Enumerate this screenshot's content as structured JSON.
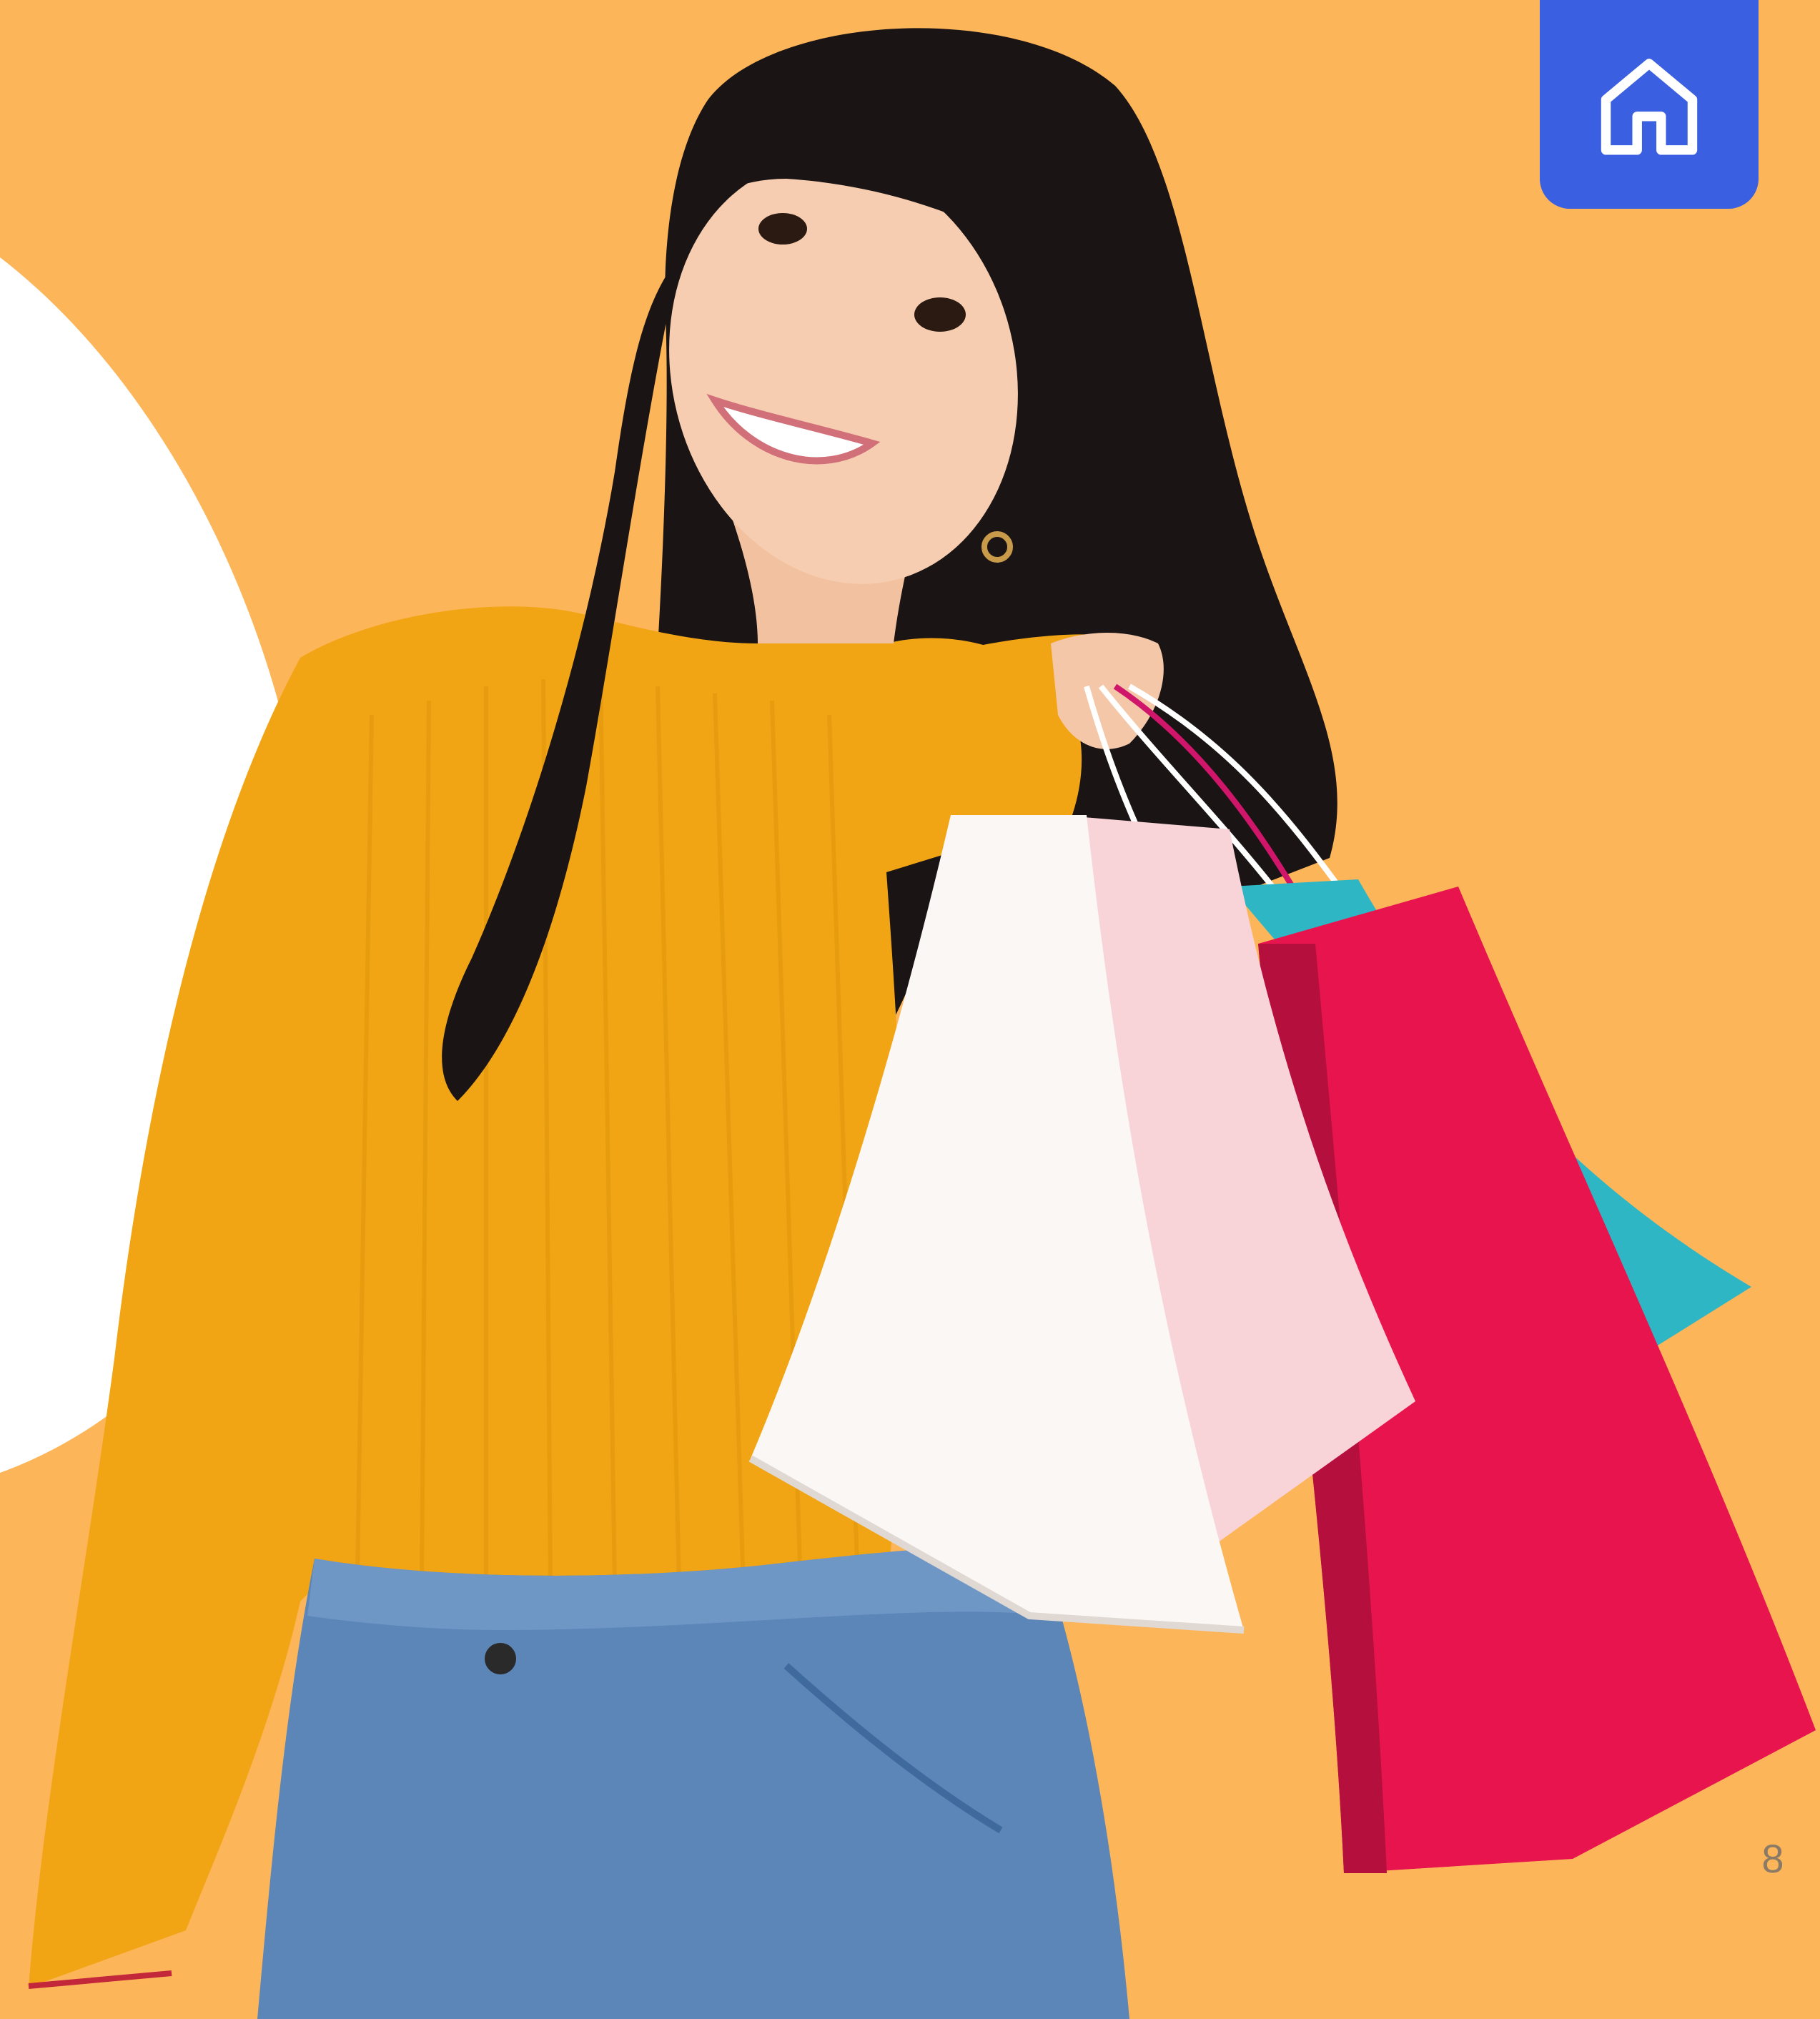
{
  "page": {
    "background_color": "#FDB55A",
    "accent_white": "#FFFFFF",
    "page_number": "8"
  },
  "nav": {
    "home_button": {
      "icon": "home-icon",
      "color": "#3A5FE0"
    }
  },
  "photo": {
    "subject": "woman-with-shopping-bags",
    "sweater_color": "#F2A514",
    "jeans_color": "#5C86B8",
    "hair_color": "#1A1414",
    "bag_colors": [
      "#FBF7F4",
      "#F8D4D8",
      "#E8144E",
      "#2FB6C4"
    ]
  }
}
